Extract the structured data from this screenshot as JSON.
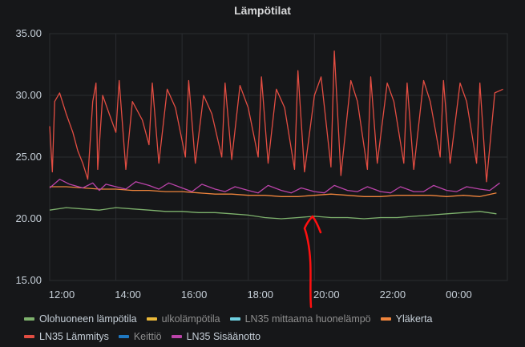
{
  "panel": {
    "title": "Lämpötilat",
    "colors": {
      "background": "#161719",
      "grid": "#2a2c30",
      "text": "#d8d9da"
    }
  },
  "chart_data": {
    "type": "line",
    "title": "Lämpötilat",
    "xlabel": "",
    "ylabel": "",
    "ylim": [
      15,
      35
    ],
    "xlim": [
      "12:00",
      "01:50"
    ],
    "y_ticks": [
      "15.00",
      "20.00",
      "25.00",
      "30.00",
      "35.00"
    ],
    "x_ticks": [
      "12:00",
      "14:00",
      "16:00",
      "18:00",
      "20:00",
      "22:00",
      "00:00"
    ],
    "x_tick_hours": [
      0,
      2,
      4,
      6,
      8,
      10,
      12
    ],
    "grid": true,
    "legend_position": "bottom",
    "series": [
      {
        "name": "Olohuoneen lämpötila",
        "color": "#7eb26d",
        "x": [
          0,
          0.5,
          1,
          1.5,
          2,
          2.5,
          3,
          3.5,
          4,
          4.5,
          5,
          5.5,
          6,
          6.5,
          7,
          7.5,
          8,
          8.5,
          9,
          9.5,
          10,
          10.5,
          11,
          11.5,
          12,
          12.5,
          13,
          13.5
        ],
        "values": [
          20.7,
          20.9,
          20.8,
          20.7,
          20.9,
          20.8,
          20.7,
          20.6,
          20.6,
          20.5,
          20.5,
          20.4,
          20.3,
          20.1,
          20.0,
          20.1,
          20.2,
          20.1,
          20.1,
          20.0,
          20.1,
          20.1,
          20.2,
          20.3,
          20.4,
          20.5,
          20.6,
          20.4
        ]
      },
      {
        "name": "ulkolämpötila",
        "color": "#eab839",
        "hidden": true,
        "x": [],
        "values": []
      },
      {
        "name": "LN35 mittaama huonelämpö",
        "color": "#6ed0e0",
        "hidden": true,
        "x": [],
        "values": []
      },
      {
        "name": "Yläkerta",
        "color": "#ef843c",
        "x": [
          0,
          0.5,
          1,
          1.5,
          2,
          2.5,
          3,
          3.5,
          4,
          4.5,
          5,
          5.5,
          6,
          6.5,
          7,
          7.5,
          8,
          8.5,
          9,
          9.5,
          10,
          10.5,
          11,
          11.5,
          12,
          12.5,
          13,
          13.5
        ],
        "values": [
          22.6,
          22.6,
          22.5,
          22.4,
          22.4,
          22.3,
          22.3,
          22.2,
          22.2,
          22.1,
          22.0,
          22.0,
          21.9,
          21.9,
          21.8,
          21.8,
          21.9,
          22.0,
          21.9,
          21.8,
          21.8,
          21.9,
          21.9,
          21.9,
          21.8,
          21.9,
          21.8,
          22.1
        ]
      },
      {
        "name": "LN35 Lämmitys",
        "color": "#e24d42",
        "x": [
          0,
          0.08,
          0.15,
          0.3,
          0.5,
          0.7,
          0.85,
          1.0,
          1.15,
          1.3,
          1.4,
          1.45,
          1.6,
          1.8,
          2.0,
          2.1,
          2.3,
          2.5,
          2.8,
          3.0,
          3.1,
          3.3,
          3.55,
          3.8,
          4.1,
          4.2,
          4.4,
          4.65,
          4.9,
          5.2,
          5.3,
          5.5,
          5.75,
          6.0,
          6.3,
          6.4,
          6.6,
          6.85,
          7.1,
          7.4,
          7.5,
          7.7,
          8.0,
          8.2,
          8.5,
          8.6,
          8.8,
          9.1,
          9.3,
          9.6,
          9.7,
          9.9,
          10.2,
          10.4,
          10.7,
          10.8,
          11.0,
          11.3,
          11.5,
          11.8,
          11.9,
          12.1,
          12.4,
          12.6,
          12.9,
          13.0,
          13.2,
          13.45,
          13.7
        ],
        "values": [
          27.5,
          23.8,
          29.5,
          30.2,
          28.5,
          27.0,
          25.5,
          24.5,
          23.2,
          29.5,
          31.0,
          24.0,
          30.0,
          28.5,
          27.0,
          31.2,
          24.0,
          29.5,
          28.0,
          26.0,
          31.0,
          24.5,
          30.5,
          29.0,
          25.0,
          31.2,
          24.5,
          30.0,
          28.5,
          25.0,
          31.0,
          24.8,
          30.8,
          29.0,
          25.0,
          31.5,
          24.5,
          30.5,
          29.0,
          24.0,
          32.0,
          23.8,
          30.0,
          31.5,
          24.2,
          33.6,
          23.5,
          31.2,
          29.5,
          24.0,
          31.5,
          24.5,
          31.0,
          29.5,
          24.5,
          31.0,
          24.0,
          31.2,
          29.5,
          25.0,
          31.2,
          24.5,
          31.0,
          29.5,
          24.5,
          31.0,
          23.0,
          30.2,
          30.5
        ]
      },
      {
        "name": "Keittiö",
        "color": "#1f78c1",
        "hidden": true,
        "x": [],
        "values": []
      },
      {
        "name": "LN35 Sisäänotto",
        "color": "#ba43a9",
        "x": [
          0,
          0.3,
          0.6,
          1.0,
          1.3,
          1.5,
          1.7,
          2.0,
          2.3,
          2.6,
          3.0,
          3.3,
          3.6,
          4.0,
          4.3,
          4.6,
          5.0,
          5.3,
          5.6,
          6.0,
          6.3,
          6.6,
          7.0,
          7.3,
          7.6,
          8.0,
          8.3,
          8.6,
          9.0,
          9.3,
          9.6,
          10.0,
          10.3,
          10.6,
          11.0,
          11.3,
          11.6,
          12.0,
          12.3,
          12.6,
          13.0,
          13.3,
          13.6
        ],
        "values": [
          22.5,
          23.2,
          22.8,
          22.5,
          22.9,
          22.3,
          22.8,
          22.6,
          22.4,
          23.0,
          22.7,
          22.4,
          22.9,
          22.5,
          22.2,
          22.8,
          22.4,
          22.2,
          22.6,
          22.3,
          22.1,
          22.7,
          22.3,
          22.1,
          22.5,
          22.2,
          22.1,
          22.7,
          22.3,
          22.2,
          22.6,
          22.2,
          22.1,
          22.6,
          22.2,
          22.2,
          22.7,
          22.3,
          22.2,
          22.6,
          22.4,
          22.3,
          22.9
        ]
      }
    ]
  }
}
